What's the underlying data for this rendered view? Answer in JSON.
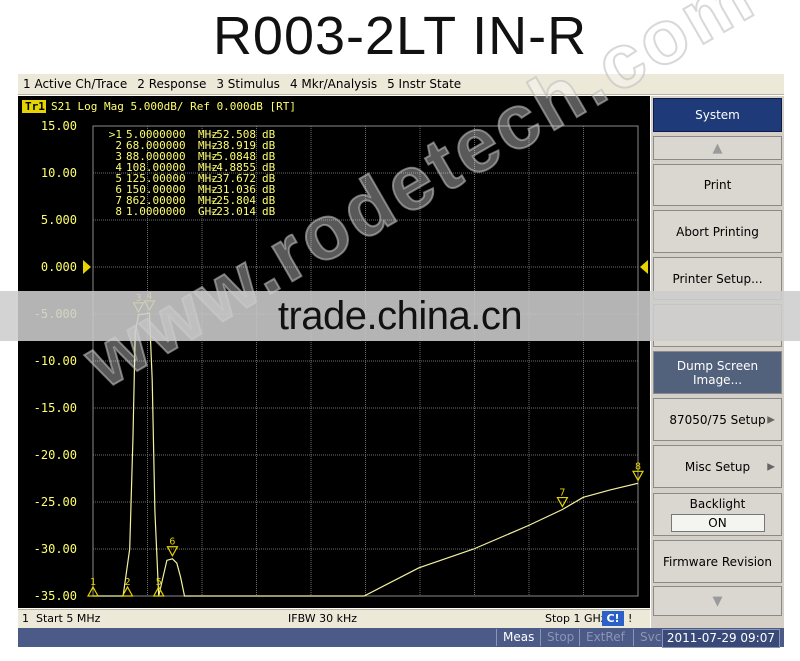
{
  "title": "R003-2LT  IN-R",
  "menu": [
    "1 Active Ch/Trace",
    "2 Response",
    "3 Stimulus",
    "4 Mkr/Analysis",
    "5 Instr State"
  ],
  "trace_header": {
    "trace_tag": "Tr1",
    "text": "S21 Log Mag 5.000dB/ Ref 0.000dB [RT]"
  },
  "markers": [
    {
      "id": ">1",
      "freq": "5.0000000",
      "unit": "MHz",
      "value": "-52.508",
      "db": "dB"
    },
    {
      "id": "2",
      "freq": "68.000000",
      "unit": "MHz",
      "value": "-38.919",
      "db": "dB"
    },
    {
      "id": "3",
      "freq": "88.000000",
      "unit": "MHz",
      "value": "-5.0848",
      "db": "dB"
    },
    {
      "id": "4",
      "freq": "108.00000",
      "unit": "MHz",
      "value": "-4.8855",
      "db": "dB"
    },
    {
      "id": "5",
      "freq": "125.00000",
      "unit": "MHz",
      "value": "-37.672",
      "db": "dB"
    },
    {
      "id": "6",
      "freq": "150.00000",
      "unit": "MHz",
      "value": "-31.036",
      "db": "dB"
    },
    {
      "id": "7",
      "freq": "862.00000",
      "unit": "MHz",
      "value": "-25.804",
      "db": "dB"
    },
    {
      "id": "8",
      "freq": "1.0000000",
      "unit": "GHz",
      "value": "-23.014",
      "db": "dB"
    }
  ],
  "yaxis": {
    "min": -35,
    "max": 15,
    "step": 5,
    "labels": [
      "15.00",
      "10.00",
      "5.000",
      "0.000",
      "-5.000",
      "-10.00",
      "-15.00",
      "-20.00",
      "-25.00",
      "-30.00",
      "-35.00"
    ],
    "ref_value": 0
  },
  "chart_data": {
    "type": "line",
    "title": "S21 Log Mag 5.000dB/ Ref 0.000dB [RT]",
    "xlabel": "",
    "ylabel": "",
    "xlim": [
      5,
      1000
    ],
    "ylim": [
      -35,
      15
    ],
    "x_unit": "MHz",
    "grid": true,
    "series": [
      {
        "name": "Tr1",
        "x": [
          5,
          40,
          60,
          72,
          78,
          82,
          88,
          100,
          108,
          113,
          118,
          125,
          140,
          150,
          158,
          165,
          172,
          180,
          200,
          240,
          300,
          400,
          500,
          600,
          700,
          800,
          862,
          900,
          950,
          1000
        ],
        "y": [
          -35,
          -35,
          -35,
          -30,
          -18,
          -7,
          -5.08,
          -5.0,
          -4.89,
          -12,
          -26,
          -37.67,
          -31.2,
          -31.04,
          -31.5,
          -33,
          -35,
          -35,
          -35,
          -35,
          -35,
          -35,
          -35,
          -32,
          -30,
          -27.5,
          -25.8,
          -24.5,
          -23.7,
          -23.01
        ]
      }
    ],
    "marker_x": [
      5,
      68,
      88,
      108,
      125,
      150,
      862,
      1000
    ],
    "marker_y": [
      -52.508,
      -38.919,
      -5.0848,
      -4.8855,
      -37.672,
      -31.036,
      -25.804,
      -23.014
    ]
  },
  "softkeys": [
    {
      "label": "System",
      "style": "head",
      "sub": null,
      "arrow": false
    },
    {
      "label": "▲",
      "style": "scroll",
      "sub": null,
      "arrow": false
    },
    {
      "label": "Print",
      "style": "normal",
      "sub": null,
      "arrow": false
    },
    {
      "label": "Abort Printing",
      "style": "normal",
      "sub": null,
      "arrow": false
    },
    {
      "label": "Printer Setup...",
      "style": "normal",
      "sub": null,
      "arrow": false
    },
    {
      "label": "",
      "style": "normal",
      "sub": null,
      "arrow": false
    },
    {
      "label": "Dump Screen Image...",
      "style": "dark",
      "sub": null,
      "arrow": false
    },
    {
      "label": "87050/75 Setup",
      "style": "normal",
      "sub": null,
      "arrow": true
    },
    {
      "label": "Misc Setup",
      "style": "normal",
      "sub": null,
      "arrow": true
    },
    {
      "label": "Backlight",
      "style": "normal",
      "sub": "ON",
      "arrow": false
    },
    {
      "label": "Firmware Revision",
      "style": "normal",
      "sub": null,
      "arrow": false
    },
    {
      "label": "▼",
      "style": "scroll",
      "sub": null,
      "arrow": false
    }
  ],
  "status": {
    "channel": "1",
    "start": "Start 5 MHz",
    "ifbw": "IFBW 30 kHz",
    "stop": "Stop 1 GHz",
    "ci": "C!",
    "bang": "!"
  },
  "bottom": {
    "meas": "Meas",
    "stop": "Stop",
    "extref": "ExtRef",
    "svc": "Svc",
    "datetime": "2011-07-29 09:07"
  },
  "banner": "trade.china.cn",
  "watermark": "www.rodetech.com",
  "colors": {
    "trace": "#f2f2a0",
    "grid": "#6e6e6e",
    "text_yellow": "#ffff6e",
    "marker_gold": "#e6d400",
    "background": "#000000"
  }
}
